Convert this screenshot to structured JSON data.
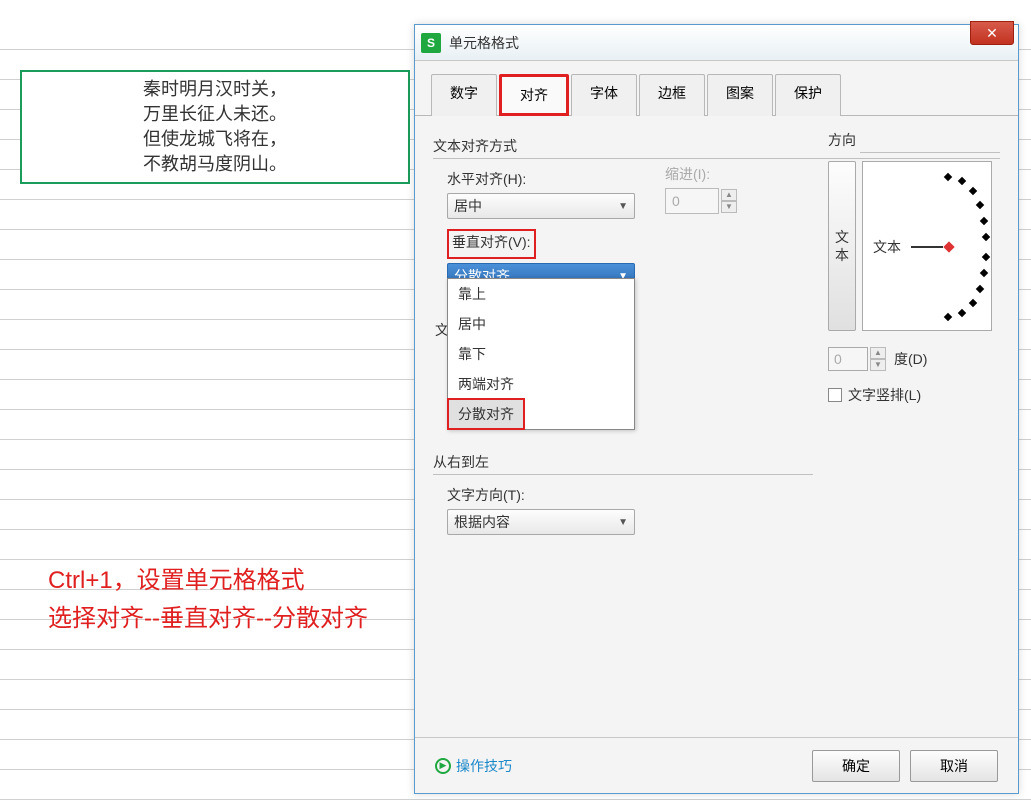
{
  "cell": {
    "lines": [
      "秦时明月汉时关，",
      "万里长征人未还。",
      "但使龙城飞将在，",
      "不教胡马度阴山。"
    ]
  },
  "instruction": {
    "line1": "Ctrl+1，设置单元格格式",
    "line2": "选择对齐--垂直对齐--分散对齐"
  },
  "dialog": {
    "title": "单元格格式",
    "tabs": [
      "数字",
      "对齐",
      "字体",
      "边框",
      "图案",
      "保护"
    ],
    "active_tab": 1,
    "section_align": "文本对齐方式",
    "h_align_label": "水平对齐(H):",
    "h_align_value": "居中",
    "indent_label": "缩进(I):",
    "indent_value": "0",
    "v_align_label": "垂直对齐(V):",
    "v_align_value": "分散对齐",
    "v_align_options": [
      "靠上",
      "居中",
      "靠下",
      "两端对齐",
      "分散对齐"
    ],
    "section_rtl": "从右到左",
    "text_dir_label": "文字方向(T):",
    "text_dir_value": "根据内容",
    "direction_title": "方向",
    "vert_text": "文本",
    "dial_text": "文本",
    "degree_value": "0",
    "degree_label": "度(D)",
    "vertical_text_label": "文字竖排(L)",
    "help": "操作技巧",
    "ok": "确定",
    "cancel": "取消",
    "truncated_label": "文"
  }
}
